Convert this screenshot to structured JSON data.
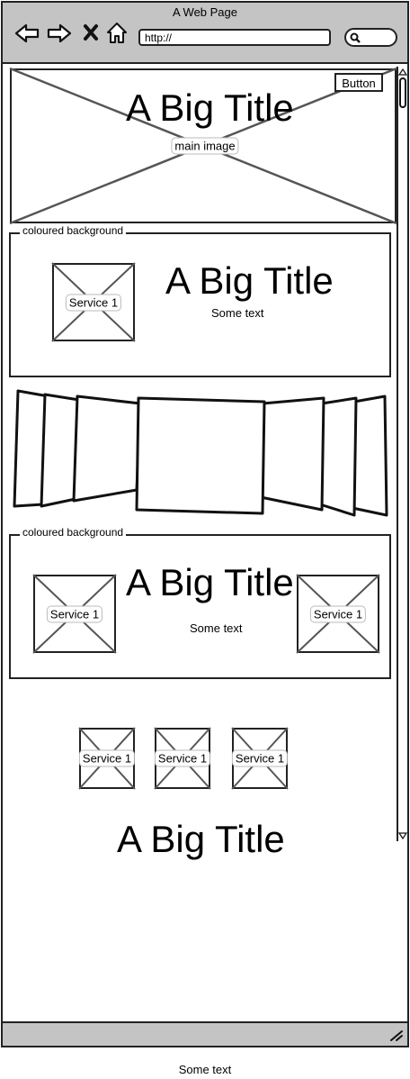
{
  "window": {
    "title": "A Web Page"
  },
  "toolbar": {
    "url_value": "http://",
    "back_icon": "arrow-left-icon",
    "forward_icon": "arrow-right-icon",
    "close_icon": "x-icon",
    "home_icon": "home-icon",
    "search_icon": "magnifier-icon"
  },
  "hero": {
    "title": "A Big Title",
    "image_label": "main image",
    "button_label": "Button"
  },
  "section1": {
    "legend": "coloured background",
    "service_label": "Service 1",
    "title": "A Big Title",
    "text": "Some text"
  },
  "section2": {
    "legend": "coloured background",
    "left_service_label": "Service 1",
    "right_service_label": "Service 1",
    "title": "A Big Title",
    "text": "Some text"
  },
  "services_row": {
    "items": [
      {
        "label": "Service 1"
      },
      {
        "label": "Service 1"
      },
      {
        "label": "Service 1"
      }
    ],
    "title": "A Big Title"
  },
  "footer": {
    "text": "Some text"
  }
}
